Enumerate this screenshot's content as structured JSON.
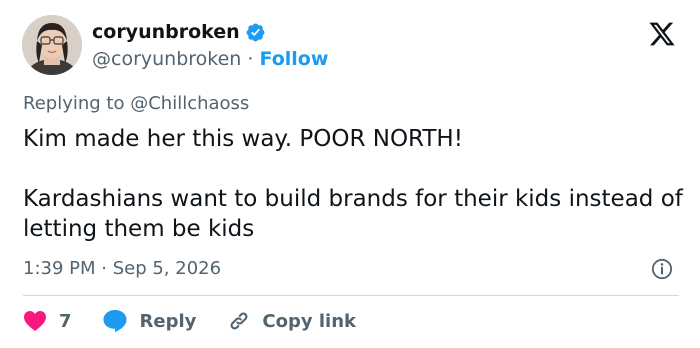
{
  "author": {
    "display_name": "coryunbroken",
    "handle": "@coryunbroken",
    "separator": "·",
    "follow_label": "Follow"
  },
  "reply_context": {
    "prefix": "Replying to",
    "mention": "@Chillchaoss"
  },
  "tweet": {
    "paragraphs": [
      "Kim made her this way. POOR NORTH!",
      "Kardashians want to build brands for their kids instead of letting them be kids"
    ],
    "timestamp": "1:39 PM · Sep 5, 2026"
  },
  "actions": {
    "like_count": "7",
    "reply_label": "Reply",
    "copy_link_label": "Copy link"
  },
  "colors": {
    "verified": "#1d9bf0",
    "link": "#1d9bf0",
    "like": "#f91880",
    "reply": "#1d9bf0",
    "muted": "#536471"
  },
  "icons": [
    "verified-badge-icon",
    "x-logo-icon",
    "info-icon",
    "heart-icon",
    "reply-bubble-icon",
    "link-icon"
  ]
}
